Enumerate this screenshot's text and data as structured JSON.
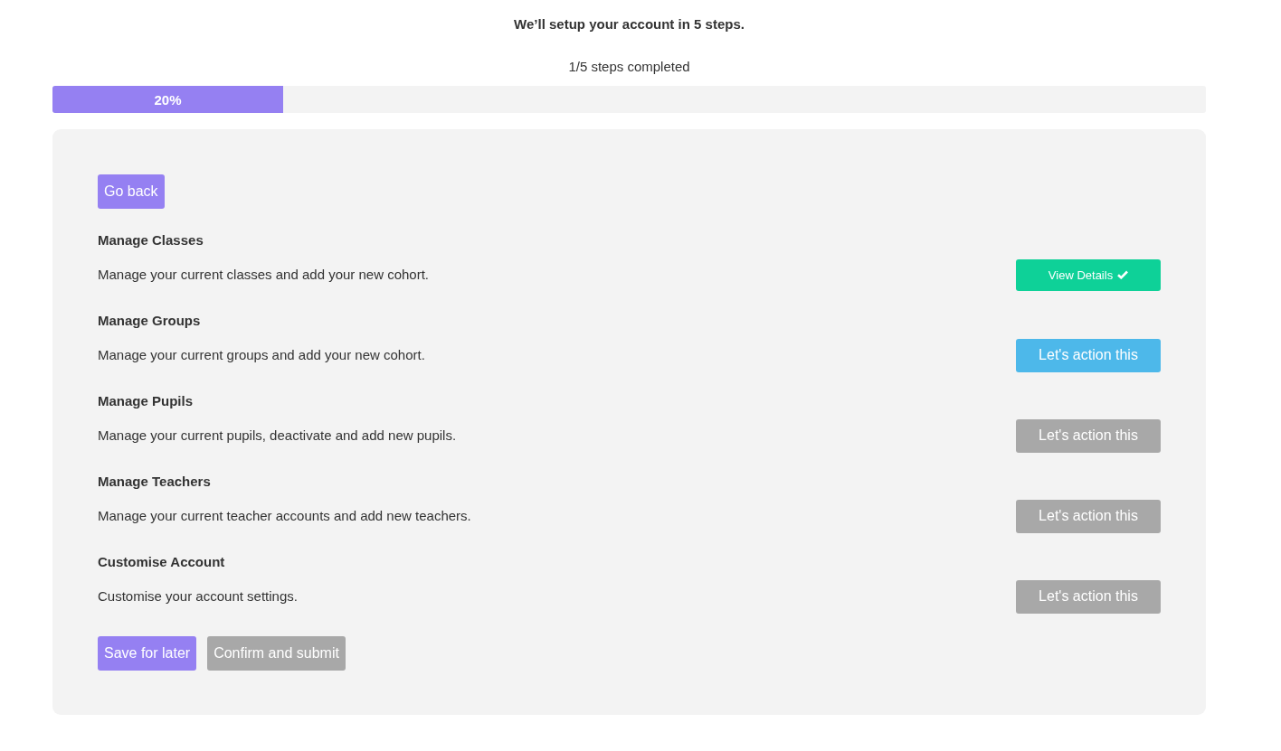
{
  "heading": "We’ll setup your account in 5 steps.",
  "progress": {
    "caption": "1/5 steps completed",
    "label": "20%",
    "level": 0.2
  },
  "back_button": "Go back",
  "steps": [
    {
      "title": "Manage Classes",
      "description": "Manage your current classes and add your new cohort.",
      "button": "View Details",
      "kind": "done"
    },
    {
      "title": "Manage Groups",
      "description": "Manage your current groups and add your new cohort.",
      "button": "Let's action this",
      "kind": "active"
    },
    {
      "title": "Manage Pupils",
      "description": "Manage your current pupils, deactivate and add new pupils.",
      "button": "Let's action this",
      "kind": "pending"
    },
    {
      "title": "Manage Teachers",
      "description": "Manage your current teacher accounts and add new teachers.",
      "button": "Let's action this",
      "kind": "pending"
    },
    {
      "title": "Customise Account",
      "description": "Customise your account settings.",
      "button": "Let's action this",
      "kind": "pending"
    }
  ],
  "footer": {
    "save": "Save for later",
    "submit": {
      "label": "Confirm and submit",
      "disabled": true
    }
  }
}
